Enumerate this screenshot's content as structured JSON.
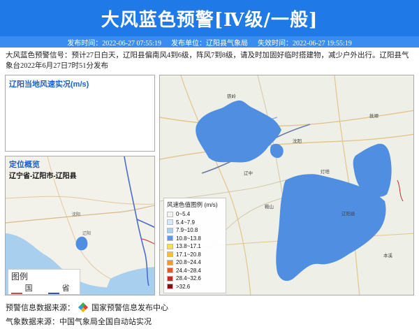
{
  "banner": {
    "title": "大风蓝色预警[Ⅳ级/一般]"
  },
  "meta": {
    "publish_time": "发布时间：2022-06-27 07:55:19",
    "publisher": "发布单位：辽阳县气象局",
    "expire_time": "失效时间：2022-06-27 19:55:19"
  },
  "description": "大风蓝色预警信号：预计27日白天，辽阳县偏南风4到6级，阵风7到8级，请及时加固好临时搭建物，减少户外出行。辽阳县气象台2022年6月27日7时51分发布",
  "wind_panel": {
    "title": "辽阳当地风速实况(m/s)"
  },
  "location_panel": {
    "title": "定位概览",
    "subtitle": "辽宁省-辽阳市-辽阳县",
    "legend_title": "图例",
    "legend_items": [
      {
        "label": "国界",
        "color": "#c0504d"
      },
      {
        "label": "省界",
        "color": "#2f55b8"
      }
    ]
  },
  "scale": {
    "title": "风速色值图例 (m/s)",
    "items": [
      {
        "label": "0~5.4",
        "color": "#f3f3f3"
      },
      {
        "label": "5.4~7.9",
        "color": "#d6e8fb"
      },
      {
        "label": "7.9~10.8",
        "color": "#a9d0f5"
      },
      {
        "label": "10.8~13.8",
        "color": "#5b98e8"
      },
      {
        "label": "13.8~17.1",
        "color": "#f7e04b"
      },
      {
        "label": "17.1~20.8",
        "color": "#f6c02f"
      },
      {
        "label": "20.8~24.4",
        "color": "#f39a28"
      },
      {
        "label": "24.4~28.4",
        "color": "#e8552a"
      },
      {
        "label": "28.4~32.6",
        "color": "#c8281f"
      },
      {
        "label": ">32.6",
        "color": "#8a1010"
      }
    ]
  },
  "footer": {
    "warning_source_label": "预警信息数据来源：",
    "warning_source": "国家预警信息发布中心",
    "weather_source": "气象数据来源：中国气象局全国自动站实况"
  },
  "colors": {
    "banner": "#1f7ae8",
    "meta_bar": "#3a8df0",
    "warning_area": "#4f8ee0"
  }
}
